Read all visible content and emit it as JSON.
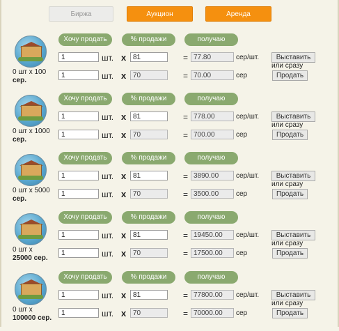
{
  "tabs": [
    {
      "label": "Биржа",
      "active": false
    },
    {
      "label": "Аукцион",
      "active": true
    },
    {
      "label": "Аренда",
      "active": true
    }
  ],
  "headers": {
    "want_sell": "Хочу продать",
    "percent": "% продажи",
    "receive": "получаю"
  },
  "labels": {
    "pcs": "шт.",
    "times": "x",
    "equals": "=",
    "per_pc": "сер/шт.",
    "total": "сер",
    "list_btn": "Выставить",
    "or_now": "или сразу",
    "sell_btn": "Продать"
  },
  "rows": [
    {
      "qty_line1": "0 шт х 100",
      "qty_line2": "сер.",
      "q1": "1",
      "p1": "81",
      "r1": "77.80",
      "q2": "1",
      "p2": "70",
      "r2": "70.00"
    },
    {
      "qty_line1": "0 шт х 1000",
      "qty_line2": "сер.",
      "q1": "1",
      "p1": "81",
      "r1": "778.00",
      "q2": "1",
      "p2": "70",
      "r2": "700.00"
    },
    {
      "qty_line1": "0 шт х 5000",
      "qty_line2": "сер.",
      "q1": "1",
      "p1": "81",
      "r1": "3890.00",
      "q2": "1",
      "p2": "70",
      "r2": "3500.00"
    },
    {
      "qty_line1": "0 шт х",
      "qty_line2": "25000 сер.",
      "q1": "1",
      "p1": "81",
      "r1": "19450.00",
      "q2": "1",
      "p2": "70",
      "r2": "17500.00"
    },
    {
      "qty_line1": "0 шт х",
      "qty_line2": "100000 сер.",
      "q1": "1",
      "p1": "81",
      "r1": "77800.00",
      "q2": "1",
      "p2": "70",
      "r2": "70000.00"
    }
  ]
}
